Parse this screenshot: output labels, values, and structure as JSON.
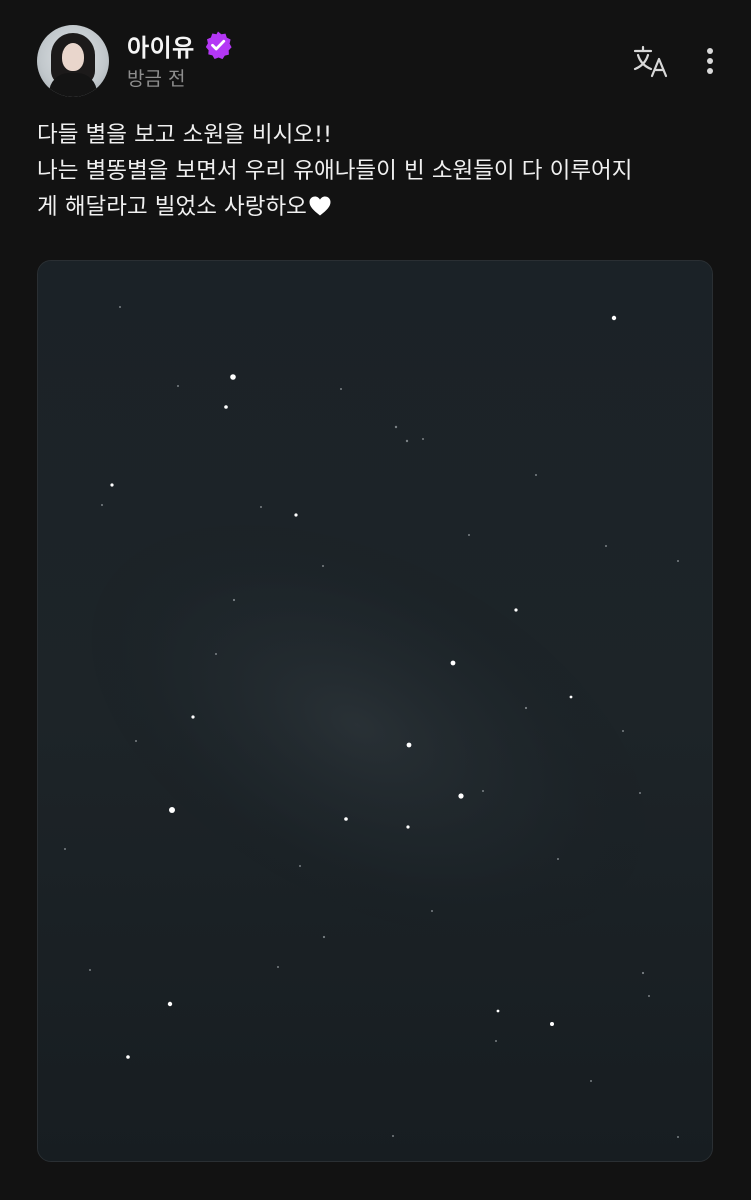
{
  "post": {
    "author": {
      "name": "아이유",
      "verified": true,
      "avatar_icon": "profile-photo-avatar",
      "badge_color": "#b437f5"
    },
    "timestamp": "방금 전",
    "actions": {
      "translate_icon": "translate-icon",
      "more_icon": "more-vertical-icon"
    },
    "text_lines": [
      "다들 별을 보고 소원을 비시오!!",
      "나는 별똥별을 보면서 우리 유애나들이 빈 소원들이 다 이루어지",
      "게 해달라고 빌었소 사랑하오"
    ],
    "text_end_icon": "heart-icon",
    "image": {
      "subject": "night-sky-stars-photo"
    }
  },
  "colors": {
    "background": "#121212",
    "text": "#f0f0f0",
    "muted": "#8e8e8e",
    "sky": "#1a2126"
  }
}
